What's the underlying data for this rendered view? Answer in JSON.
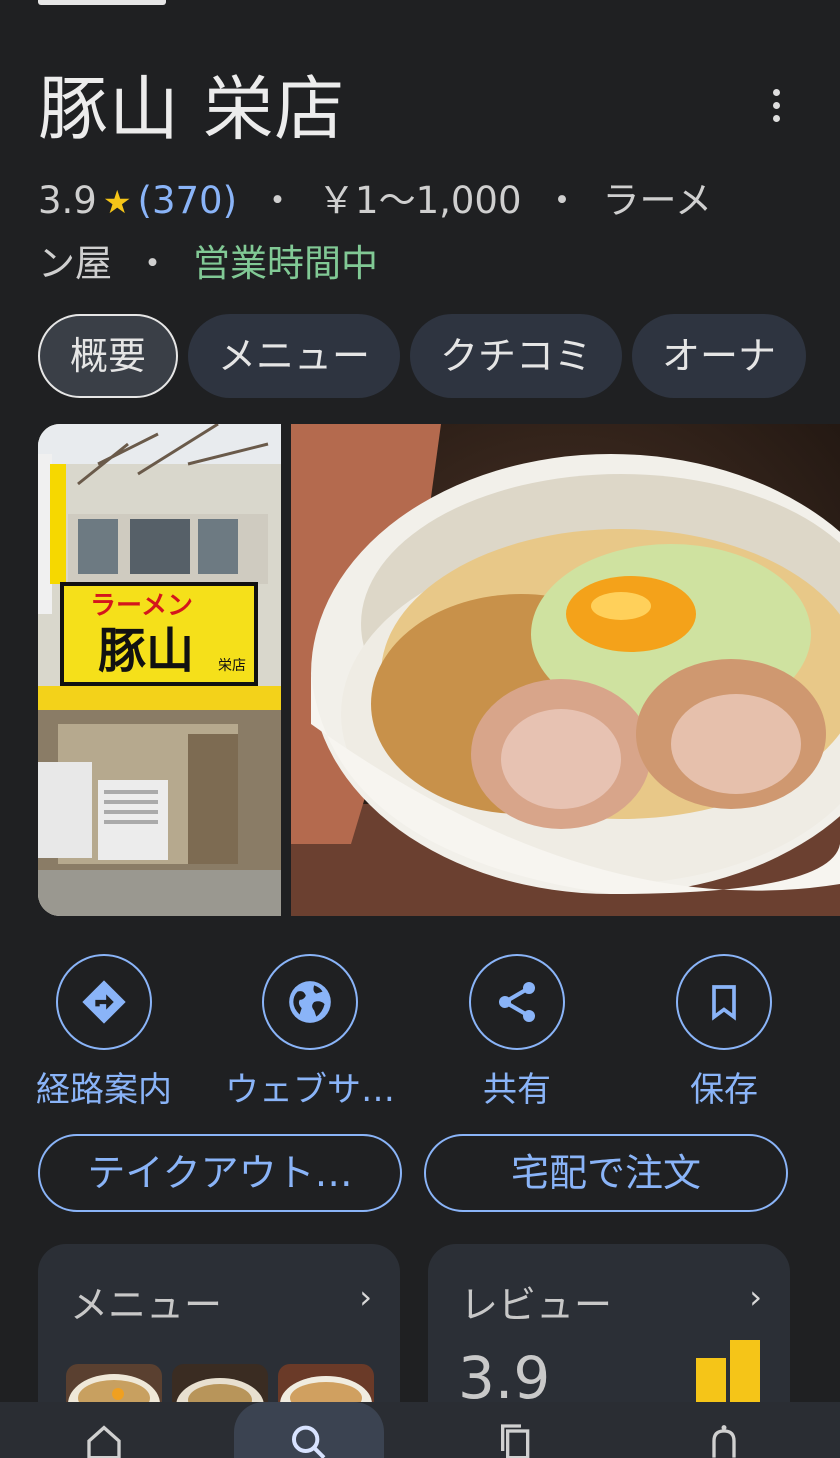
{
  "place": {
    "name": "豚山 栄店",
    "rating": "3.9",
    "reviews": "(370)",
    "price": "￥1〜1,000",
    "category_a": "ラーメ",
    "category_b": "ン屋",
    "status": "営業時間中"
  },
  "tabs": [
    "概要",
    "メニュー",
    "クチコミ",
    "オーナ"
  ],
  "photos": {
    "store_sign_top": "ラーメン",
    "store_sign_main": "豚山",
    "store_sign_sub": "栄店"
  },
  "actions": {
    "directions": "経路案内",
    "website": "ウェブサ…",
    "share": "共有",
    "save": "保存"
  },
  "buttons": {
    "takeout": "テイクアウト…",
    "delivery": "宅配で注文"
  },
  "cards": {
    "menu_title": "メニュー",
    "review_title": "レビュー",
    "review_score": "3.9",
    "chevron": "›"
  },
  "colors": {
    "background": "#1f2022",
    "accent": "#8ab4f8",
    "open_status": "#81c995",
    "star": "#f5c518",
    "bar_chart": "#f5c518"
  },
  "icons": {
    "more": "more-vert-icon",
    "directions": "directions-icon",
    "website": "globe-icon",
    "share": "share-icon",
    "save": "bookmark-icon",
    "nav_explore": "home-icon",
    "nav_search": "search-icon",
    "nav_saved": "copy-icon",
    "nav_notifications": "bell-icon"
  }
}
